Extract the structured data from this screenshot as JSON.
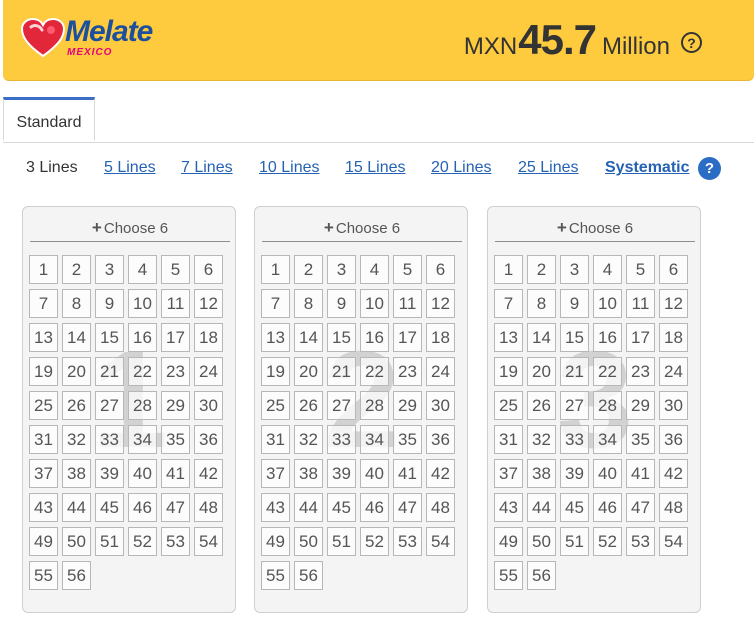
{
  "header": {
    "logo_text": "Melate",
    "logo_subtext": "MEXICO",
    "jackpot_currency": "MXN",
    "jackpot_amount": "45.7",
    "jackpot_unit": "Million",
    "help_glyph": "?"
  },
  "tabs": [
    {
      "label": "Standard",
      "active": true
    }
  ],
  "line_options": [
    {
      "label": "3 Lines",
      "selected": true
    },
    {
      "label": "5 Lines",
      "selected": false
    },
    {
      "label": "7 Lines",
      "selected": false
    },
    {
      "label": "10 Lines",
      "selected": false
    },
    {
      "label": "15 Lines",
      "selected": false
    },
    {
      "label": "20 Lines",
      "selected": false
    },
    {
      "label": "25 Lines",
      "selected": false
    },
    {
      "label": "Systematic",
      "selected": false
    }
  ],
  "systematic_help_glyph": "?",
  "cards": [
    {
      "number": "1",
      "header": "Choose 6",
      "plus_icon": "plus-icon"
    },
    {
      "number": "2",
      "header": "Choose 6",
      "plus_icon": "plus-icon"
    },
    {
      "number": "3",
      "header": "Choose 6",
      "plus_icon": "plus-icon"
    }
  ],
  "numbers": [
    "1",
    "2",
    "3",
    "4",
    "5",
    "6",
    "7",
    "8",
    "9",
    "10",
    "11",
    "12",
    "13",
    "14",
    "15",
    "16",
    "17",
    "18",
    "19",
    "20",
    "21",
    "22",
    "23",
    "24",
    "25",
    "26",
    "27",
    "28",
    "29",
    "30",
    "31",
    "32",
    "33",
    "34",
    "35",
    "36",
    "37",
    "38",
    "39",
    "40",
    "41",
    "42",
    "43",
    "44",
    "45",
    "46",
    "47",
    "48",
    "49",
    "50",
    "51",
    "52",
    "53",
    "54",
    "55",
    "56"
  ],
  "colors": {
    "header_bg": "#fecb3e",
    "brand_blue": "#1d4f9c",
    "link_blue": "#2462b3",
    "tab_accent": "#3b6fc6"
  }
}
